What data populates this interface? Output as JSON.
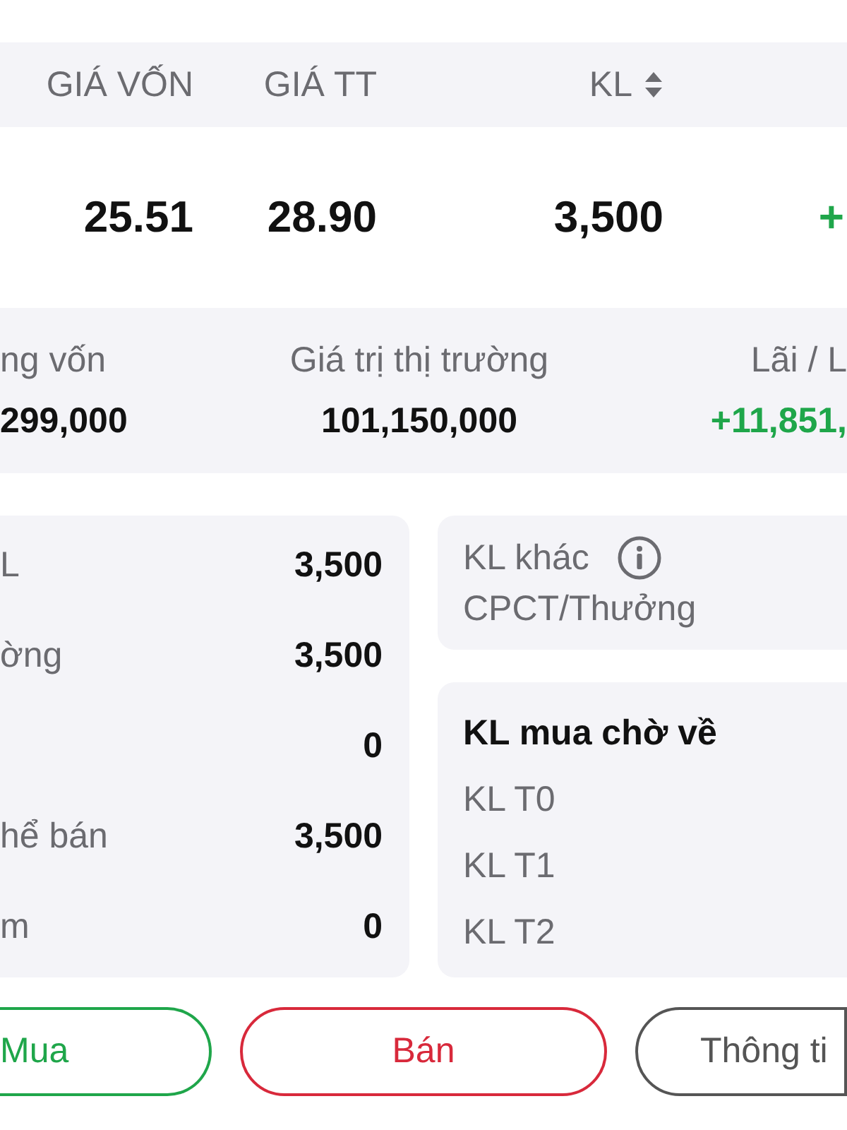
{
  "table": {
    "columns": [
      {
        "label": "GIÁ VỐN",
        "sortable": false
      },
      {
        "label": "GIÁ TT",
        "sortable": false
      },
      {
        "label": "KL",
        "sortable": true
      }
    ],
    "row": {
      "cells": [
        "25.51",
        "28.90",
        "3,500"
      ],
      "change": "+"
    }
  },
  "summary": [
    {
      "label": "ng vốn",
      "value": "299,000",
      "color": "#111111"
    },
    {
      "label": "Giá trị thị trường",
      "value": "101,150,000",
      "color": "#111111"
    },
    {
      "label": "Lãi / L",
      "value": "+11,851,",
      "color": "#1fa64a"
    }
  ],
  "holdings": [
    {
      "label": "L",
      "value": "3,500"
    },
    {
      "label": "ờng",
      "value": "3,500"
    },
    {
      "value": "0"
    },
    {
      "label": "hể bán",
      "value": "3,500"
    },
    {
      "label": "m",
      "value": "0"
    }
  ],
  "other": {
    "title": "KL khác",
    "info": true,
    "items": [
      "CPCT/Thưởng"
    ]
  },
  "pending": {
    "title": "KL mua chờ về",
    "items": [
      "KL T0",
      "KL T1",
      "KL T2"
    ]
  },
  "actions": [
    {
      "label": "Mua",
      "kind": "buy"
    },
    {
      "label": "Bán",
      "kind": "sell"
    },
    {
      "label": "Thông ti",
      "kind": "info"
    }
  ]
}
